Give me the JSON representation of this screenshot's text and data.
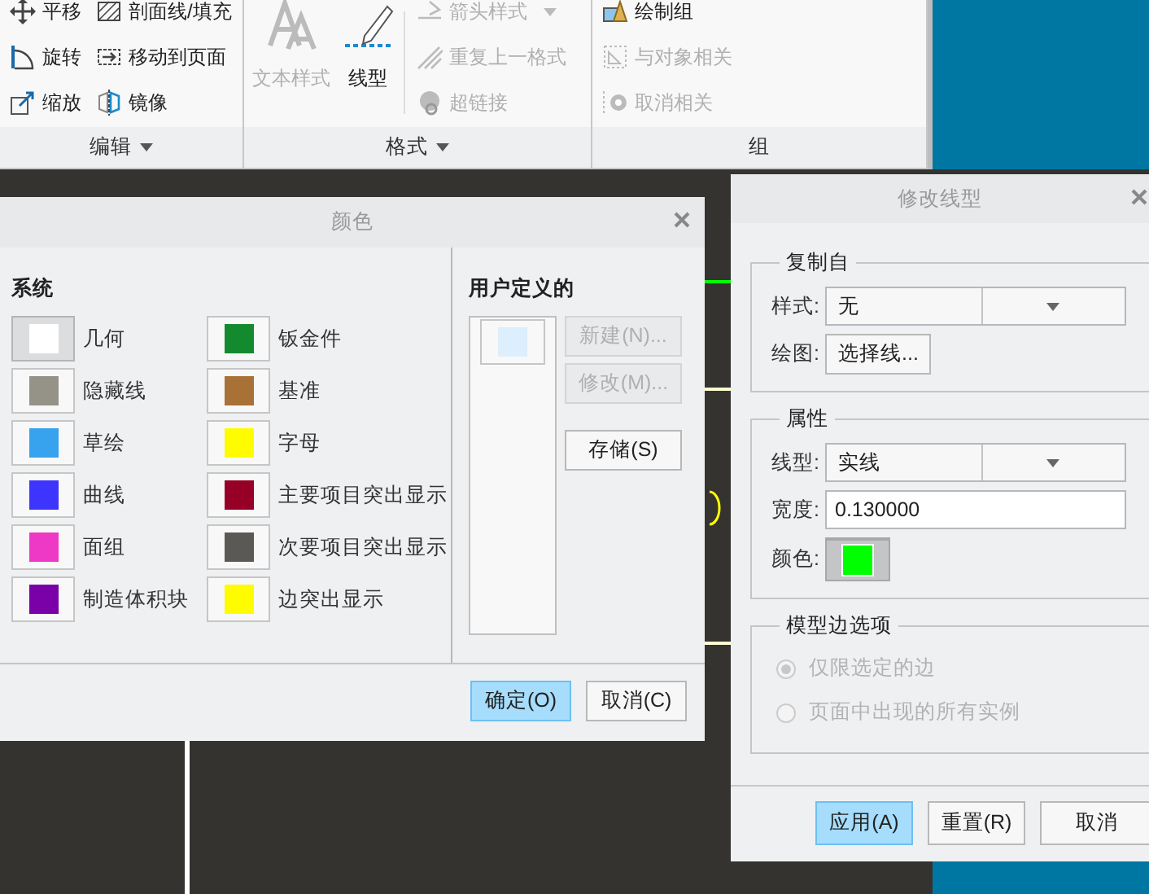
{
  "ribbon": {
    "groups": [
      {
        "label": "编辑",
        "has_menu": true,
        "tool_columns": [
          [
            {
              "label": "平移",
              "disabled": false,
              "has_menu": false
            },
            {
              "label": "旋转",
              "disabled": false,
              "has_menu": false
            },
            {
              "label": "缩放",
              "disabled": false,
              "has_menu": false
            }
          ],
          [
            {
              "label": "剖面线/填充",
              "disabled": false,
              "has_menu": false
            },
            {
              "label": "移动到页面",
              "disabled": false,
              "has_menu": false
            },
            {
              "label": "镜像",
              "disabled": false,
              "has_menu": false
            }
          ]
        ]
      },
      {
        "label": "格式",
        "has_menu": true,
        "large_tools": [
          {
            "label": "文本样式",
            "disabled": true
          },
          {
            "label": "线型",
            "disabled": false
          }
        ],
        "tool_columns": [
          [
            {
              "label": "箭头样式",
              "disabled": true,
              "has_menu": true
            },
            {
              "label": "重复上一格式",
              "disabled": true,
              "has_menu": false
            },
            {
              "label": "超链接",
              "disabled": true,
              "has_menu": false
            }
          ]
        ]
      },
      {
        "label": "组",
        "has_menu": false,
        "tool_columns": [
          [
            {
              "label": "绘制组",
              "disabled": false,
              "has_menu": false
            },
            {
              "label": "与对象相关",
              "disabled": true,
              "has_menu": false
            },
            {
              "label": "取消相关",
              "disabled": true,
              "has_menu": false
            }
          ]
        ]
      }
    ]
  },
  "color_dialog": {
    "title": "颜色",
    "system_heading": "系统",
    "system_colors": [
      {
        "name": "几何",
        "color": "#ffffff",
        "selected": true
      },
      {
        "name": "隐藏线",
        "color": "#959288",
        "selected": false
      },
      {
        "name": "草绘",
        "color": "#37a2ee",
        "selected": false
      },
      {
        "name": "曲线",
        "color": "#3d35fd",
        "selected": false
      },
      {
        "name": "面组",
        "color": "#ee38c6",
        "selected": false
      },
      {
        "name": "制造体积块",
        "color": "#7a00a8",
        "selected": false
      },
      {
        "name": "钣金件",
        "color": "#148a2f",
        "selected": false
      },
      {
        "name": "基准",
        "color": "#a87236",
        "selected": false
      },
      {
        "name": "字母",
        "color": "#fffc00",
        "selected": false
      },
      {
        "name": "主要项目突出显示",
        "color": "#960027",
        "selected": false
      },
      {
        "name": "次要项目突出显示",
        "color": "#5a5955",
        "selected": false
      },
      {
        "name": "边突出显示",
        "color": "#fffc00",
        "selected": false
      }
    ],
    "user_heading": "用户定义的",
    "user_colors": [
      {
        "color": "#ddeefc",
        "selected": false
      }
    ],
    "side_buttons": [
      {
        "label": "新建(N)...",
        "disabled": true
      },
      {
        "label": "修改(M)...",
        "disabled": true
      },
      {
        "label": "存储(S)",
        "disabled": false
      }
    ],
    "footer_buttons": [
      {
        "label": "确定(O)",
        "focused": true
      },
      {
        "label": "取消(C)",
        "focused": false
      }
    ]
  },
  "line_dialog": {
    "title": "修改线型",
    "sections": [
      {
        "title": "复制自",
        "disabled": false,
        "fields": [
          {
            "kind": "dropdown",
            "label": "样式:",
            "value": "无"
          },
          {
            "kind": "button",
            "label": "绘图:",
            "value": "选择线..."
          }
        ]
      },
      {
        "title": "属性",
        "disabled": false,
        "fields": [
          {
            "kind": "dropdown",
            "label": "线型:",
            "value": "实线"
          },
          {
            "kind": "input",
            "label": "宽度:",
            "value": "0.130000"
          },
          {
            "kind": "color",
            "label": "颜色:",
            "color": "#00ff00"
          }
        ]
      },
      {
        "title": "模型边选项",
        "disabled": true,
        "fields": [
          {
            "kind": "radio",
            "label": "仅限选定的边",
            "selected": true
          },
          {
            "kind": "radio",
            "label": "页面中出现的所有实例",
            "selected": false
          }
        ]
      }
    ],
    "footer_buttons": [
      {
        "label": "应用(A)",
        "focused": true
      },
      {
        "label": "重置(R)",
        "focused": false
      },
      {
        "label": "取消",
        "focused": false
      }
    ]
  }
}
